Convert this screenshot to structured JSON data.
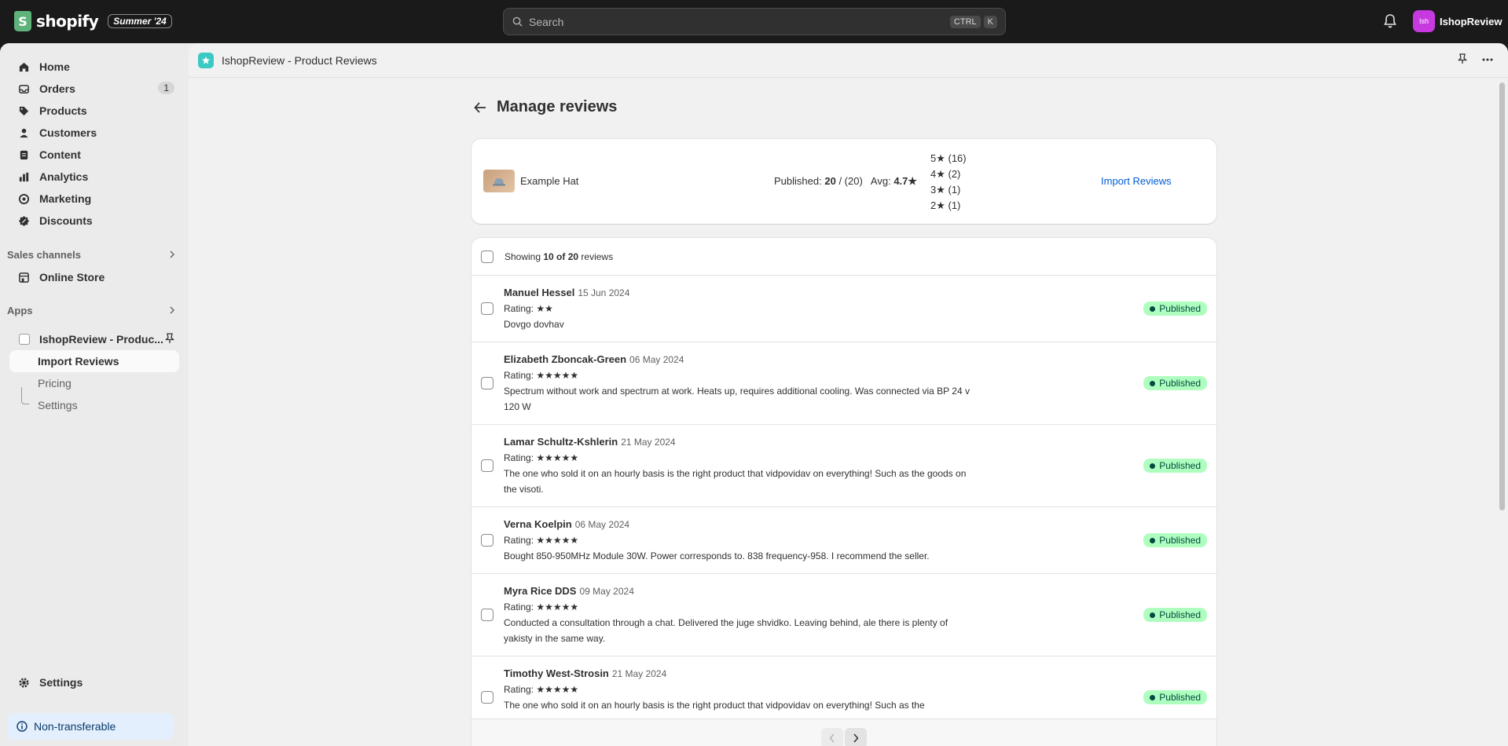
{
  "topbar": {
    "logo_letter": "S",
    "logo_word": "shopify",
    "edition_badge": "Summer '24",
    "search_placeholder": "Search",
    "shortcut_ctrl": "CTRL",
    "shortcut_key": "K",
    "avatar_initials": "Ish",
    "store_name": "IshopReview"
  },
  "sidebar": {
    "items": [
      {
        "label": "Home",
        "icon": "home-icon"
      },
      {
        "label": "Orders",
        "icon": "inbox-icon",
        "badge": "1"
      },
      {
        "label": "Products",
        "icon": "tag-icon"
      },
      {
        "label": "Customers",
        "icon": "person-icon"
      },
      {
        "label": "Content",
        "icon": "document-icon"
      },
      {
        "label": "Analytics",
        "icon": "bar-chart-icon"
      },
      {
        "label": "Marketing",
        "icon": "target-icon"
      },
      {
        "label": "Discounts",
        "icon": "discount-icon"
      }
    ],
    "sales_channels_label": "Sales channels",
    "online_store": "Online Store",
    "apps_label": "Apps",
    "app_name": "IshopReview - Produc...",
    "app_subitems": [
      "Import Reviews",
      "Pricing",
      "Settings"
    ],
    "settings": "Settings",
    "non_transferable": "Non-transferable"
  },
  "app_header": {
    "title": "IshopReview - Product Reviews"
  },
  "page": {
    "title": "Manage reviews"
  },
  "summary": {
    "product_name": "Example Hat",
    "published_label": "Published:",
    "published_count": "20",
    "published_total": "/ (20)",
    "avg_label": "Avg:",
    "avg_value": "4.7★",
    "distribution": [
      "5★ (16)",
      "4★ (2)",
      "3★ (1)",
      "2★ (1)"
    ],
    "import_link": "Import Reviews"
  },
  "reviews": {
    "showing_prefix": "Showing ",
    "showing_count": "10 of 20",
    "showing_suffix": " reviews",
    "status_label": "Published",
    "rows": [
      {
        "name": "Manuel Hessel",
        "date": "15 Jun 2024",
        "rating": "Rating: ★★",
        "text": "Dovgo dovhav"
      },
      {
        "name": "Elizabeth Zboncak-Green",
        "date": "06 May 2024",
        "rating": "Rating: ★★★★★",
        "text": "Spectrum without work and spectrum at work. Heats up, requires additional cooling. Was connected via BP 24 v 120 W"
      },
      {
        "name": "Lamar Schultz-Kshlerin",
        "date": "21 May 2024",
        "rating": "Rating: ★★★★★",
        "text": "The one who sold it on an hourly basis is the right product that vidpovidav on everything! Such as the goods on the visoti."
      },
      {
        "name": "Verna Koelpin",
        "date": "06 May 2024",
        "rating": "Rating: ★★★★★",
        "text": "Bought 850-950MHz Module 30W. Power corresponds to. 838 frequency-958. I recommend the seller."
      },
      {
        "name": "Myra Rice DDS",
        "date": "09 May 2024",
        "rating": "Rating: ★★★★★",
        "text": "Conducted a consultation through a chat. Delivered the juge shvidko. Leaving behind, ale there is plenty of yakisty in the same way."
      },
      {
        "name": "Timothy West-Strosin",
        "date": "21 May 2024",
        "rating": "Rating: ★★★★★",
        "text": "The one who sold it on an hourly basis is the right product that vidpovidav on everything! Such as the"
      }
    ]
  },
  "colors": {
    "topbar_bg": "#1a1a1a",
    "accent_link": "#005bd3",
    "badge_bg": "#affebf",
    "badge_text": "#014b40",
    "avatar_bg": "#c73ae0",
    "app_logo_bg": "#3cc8c3"
  }
}
